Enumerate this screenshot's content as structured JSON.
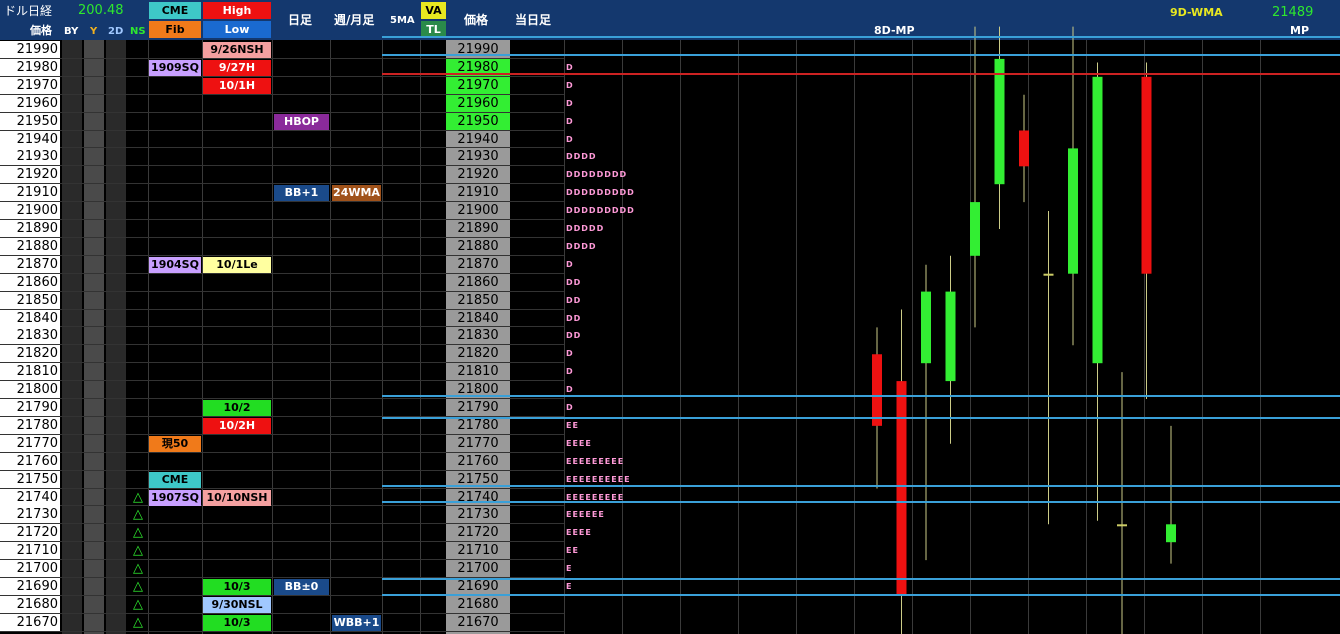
{
  "header": {
    "pair_label": "ドル日経",
    "pair_value": "200.48",
    "price_label": "価格",
    "toggles": [
      "BY",
      "Y",
      "2D",
      "NS"
    ],
    "cme_label": "CME",
    "fib_label": "Fib",
    "high_label": "High",
    "low_label": "Low",
    "daily_label": "日足",
    "weekly_label": "週/月足",
    "ma5_label": "5MA",
    "va_label": "VA",
    "tl_label": "TL",
    "price_col_label": "価格",
    "today_label": "当日足",
    "chart_label": "8D-MP",
    "wma_label": "9D-WMA",
    "mp_value": "21489",
    "mp_label": "MP"
  },
  "prices": [
    21990,
    21980,
    21970,
    21960,
    21950,
    21940,
    21930,
    21920,
    21910,
    21900,
    21890,
    21880,
    21870,
    21860,
    21850,
    21840,
    21830,
    21820,
    21810,
    21800,
    21790,
    21780,
    21770,
    21760,
    21750,
    21740,
    21730,
    21720,
    21710,
    21700,
    21690,
    21680,
    21670
  ],
  "va_highlight": [
    21980,
    21970,
    21960,
    21950
  ],
  "cme_cells": [
    {
      "price": 21980,
      "text": "1909SQ",
      "color": "#c8a0ff"
    },
    {
      "price": 21870,
      "text": "1904SQ",
      "color": "#c8a0ff"
    },
    {
      "price": 21770,
      "text": "現50",
      "color": "#f07a1a"
    },
    {
      "price": 21750,
      "text": "CME",
      "color": "#3ec8c8"
    },
    {
      "price": 21740,
      "text": "1907SQ",
      "color": "#c8a0ff"
    }
  ],
  "hl_cells": [
    {
      "price": 21990,
      "text": "9/26NSH",
      "color": "#f4a0a0"
    },
    {
      "price": 21980,
      "text": "9/27H",
      "color": "#ee1111"
    },
    {
      "price": 21970,
      "text": "10/1H",
      "color": "#ee1111"
    },
    {
      "price": 21870,
      "text": "10/1Le",
      "color": "#ffffa0"
    },
    {
      "price": 21790,
      "text": "10/2",
      "color": "#22dd22"
    },
    {
      "price": 21780,
      "text": "10/2H",
      "color": "#ee1111"
    },
    {
      "price": 21740,
      "text": "10/10NSH",
      "color": "#f4a0a0"
    },
    {
      "price": 21690,
      "text": "10/3",
      "color": "#22dd22"
    },
    {
      "price": 21680,
      "text": "9/30NSL",
      "color": "#a0c8ff"
    },
    {
      "price": 21670,
      "text": "10/3",
      "color": "#22dd22"
    }
  ],
  "daily_cells": [
    {
      "price": 21950,
      "text": "HBOP",
      "color": "#8a2a9a"
    },
    {
      "price": 21910,
      "text": "BB+1",
      "color": "#1a4a8a"
    },
    {
      "price": 21690,
      "text": "BB±0",
      "color": "#1a4a8a"
    }
  ],
  "weekly_cells": [
    {
      "price": 21910,
      "text": "24WMA",
      "color": "#a0521a"
    },
    {
      "price": 21670,
      "text": "WBB+1",
      "color": "#1a4a8a"
    }
  ],
  "triangles": [
    21740,
    21730,
    21720,
    21710,
    21700,
    21690,
    21680,
    21670
  ],
  "triangle_glyph": "△",
  "profile": [
    {
      "price": 21980,
      "text": "D"
    },
    {
      "price": 21970,
      "text": "D"
    },
    {
      "price": 21960,
      "text": "D"
    },
    {
      "price": 21950,
      "text": "D"
    },
    {
      "price": 21940,
      "text": "D"
    },
    {
      "price": 21930,
      "text": "DDDD"
    },
    {
      "price": 21920,
      "text": "DDDDDDDD"
    },
    {
      "price": 21910,
      "text": "DDDDDDDDD"
    },
    {
      "price": 21900,
      "text": "DDDDDDDDD"
    },
    {
      "price": 21890,
      "text": "DDDDD"
    },
    {
      "price": 21880,
      "text": "DDDD"
    },
    {
      "price": 21870,
      "text": "D"
    },
    {
      "price": 21860,
      "text": "DD"
    },
    {
      "price": 21850,
      "text": "DD"
    },
    {
      "price": 21840,
      "text": "DD"
    },
    {
      "price": 21830,
      "text": "DD"
    },
    {
      "price": 21820,
      "text": "D"
    },
    {
      "price": 21810,
      "text": "D"
    },
    {
      "price": 21800,
      "text": "D"
    },
    {
      "price": 21790,
      "text": "D"
    },
    {
      "price": 21780,
      "text": "EE"
    },
    {
      "price": 21770,
      "text": "EEEE"
    },
    {
      "price": 21760,
      "text": "EEEEEEEEE"
    },
    {
      "price": 21750,
      "text": "EEEEEEEEEE"
    },
    {
      "price": 21740,
      "text": "EEEEEEEEE"
    },
    {
      "price": 21730,
      "text": "EEEEEE"
    },
    {
      "price": 21720,
      "text": "EEEE"
    },
    {
      "price": 21710,
      "text": "EE"
    },
    {
      "price": 21700,
      "text": "E"
    },
    {
      "price": 21690,
      "text": "E"
    }
  ],
  "lines": [
    {
      "price": 21993,
      "color": "#3aa0d8"
    },
    {
      "price": 21983,
      "color": "#3aa0d8"
    },
    {
      "price": 21972,
      "color": "#cc2222"
    },
    {
      "price": 21792,
      "color": "#3aa0d8"
    },
    {
      "price": 21780,
      "color": "#3aa0d8"
    },
    {
      "price": 21742,
      "color": "#3aa0d8"
    },
    {
      "price": 21733,
      "color": "#3aa0d8"
    },
    {
      "price": 21690,
      "color": "#3aa0d8"
    },
    {
      "price": 21681,
      "color": "#3aa0d8"
    }
  ],
  "candles": [
    {
      "open": 21815,
      "close": 21775,
      "high": 21830,
      "low": 21740,
      "color": "#ee1111"
    },
    {
      "open": 21800,
      "close": 21680,
      "high": 21840,
      "low": 21655,
      "color": "#ee1111"
    },
    {
      "open": 21810,
      "close": 21850,
      "high": 21865,
      "low": 21700,
      "color": "#33ee33"
    },
    {
      "open": 21800,
      "close": 21850,
      "high": 21870,
      "low": 21765,
      "color": "#33ee33"
    },
    {
      "open": 21870,
      "close": 21900,
      "high": 21998,
      "low": 21830,
      "color": "#33ee33"
    },
    {
      "open": 21910,
      "close": 21980,
      "high": 21998,
      "low": 21885,
      "color": "#33ee33"
    },
    {
      "open": 21940,
      "close": 21920,
      "high": 21960,
      "low": 21900,
      "color": "#ee1111"
    },
    {
      "open": 21860,
      "close": 21860,
      "high": 21895,
      "low": 21720,
      "color": "#cccc66"
    },
    {
      "open": 21860,
      "close": 21930,
      "high": 21998,
      "low": 21820,
      "color": "#33ee33"
    },
    {
      "open": 21810,
      "close": 21970,
      "high": 21978,
      "low": 21722,
      "color": "#33ee33"
    },
    {
      "open": 21720,
      "close": 21720,
      "high": 21805,
      "low": 21650,
      "color": "#cccc66"
    },
    {
      "open": 21970,
      "close": 21860,
      "high": 21978,
      "low": 21790,
      "color": "#ee1111"
    },
    {
      "open": 21710,
      "close": 21720,
      "high": 21775,
      "low": 21698,
      "color": "#33ee33"
    }
  ]
}
